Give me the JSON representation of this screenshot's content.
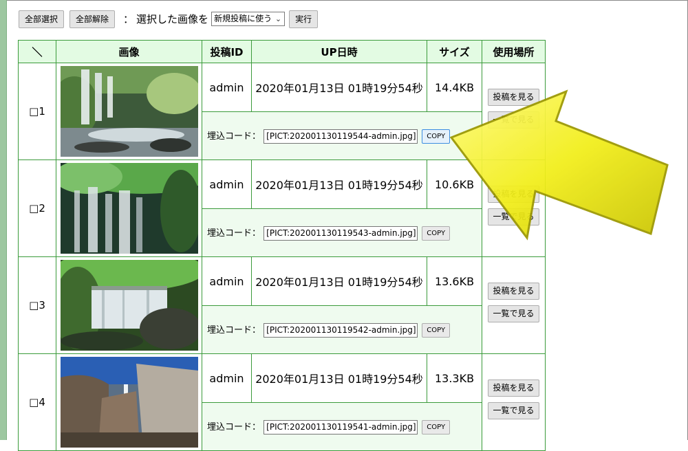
{
  "toolbar": {
    "select_all_label": "全部選択",
    "deselect_all_label": "全部解除",
    "colon": "：",
    "selected_text": "選択した画像を",
    "action_select_value": "新規投稿に使う",
    "execute_label": "実行"
  },
  "table": {
    "headers": {
      "check": "＼",
      "image": "画像",
      "post_id": "投稿ID",
      "up_time": "UP日時",
      "size": "サイズ",
      "usage": "使用場所"
    },
    "embed_label": "埋込コード：",
    "copy_label": "COPY",
    "view_post_label": "投稿を見る",
    "view_list_label": "一覧で見る",
    "rows": [
      {
        "num": "□1",
        "post_id": "admin",
        "up_time": "2020年01月13日 01時19分54秒",
        "size": "14.4KB",
        "embed": "[PICT:202001130119544-admin.jpg]"
      },
      {
        "num": "□2",
        "post_id": "admin",
        "up_time": "2020年01月13日 01時19分54秒",
        "size": "10.6KB",
        "embed": "[PICT:202001130119543-admin.jpg]"
      },
      {
        "num": "□3",
        "post_id": "admin",
        "up_time": "2020年01月13日 01時19分54秒",
        "size": "13.6KB",
        "embed": "[PICT:202001130119542-admin.jpg]"
      },
      {
        "num": "□4",
        "post_id": "admin",
        "up_time": "2020年01月13日 01時19分54秒",
        "size": "13.3KB",
        "embed": "[PICT:202001130119541-admin.jpg]"
      }
    ]
  },
  "colors": {
    "border": "#3a9a3a",
    "header_bg": "#e3fbe3",
    "embed_bg": "#effbef",
    "arrow": "#f2ee18"
  }
}
